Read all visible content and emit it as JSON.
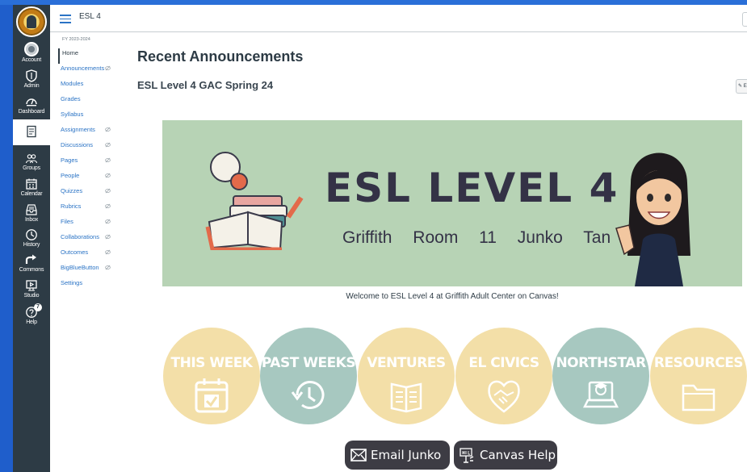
{
  "global_nav": {
    "items": [
      {
        "label": "Account",
        "icon": "account-avatar"
      },
      {
        "label": "Admin",
        "icon": "shield-icon"
      },
      {
        "label": "Dashboard",
        "icon": "dashboard-icon"
      },
      {
        "label": "",
        "icon": "courses-icon"
      },
      {
        "label": "Groups",
        "icon": "groups-icon"
      },
      {
        "label": "Calendar",
        "icon": "calendar-icon"
      },
      {
        "label": "Inbox",
        "icon": "inbox-icon"
      },
      {
        "label": "History",
        "icon": "history-icon"
      },
      {
        "label": "Commons",
        "icon": "commons-icon"
      },
      {
        "label": "Studio",
        "icon": "studio-icon"
      },
      {
        "label": "Help",
        "icon": "help-icon",
        "badge": "7"
      }
    ]
  },
  "header": {
    "course_name": "ESL 4"
  },
  "course_nav": {
    "term": "FY 2023-2024",
    "items": [
      {
        "label": "Home",
        "hidden": false,
        "active": true
      },
      {
        "label": "Announcements",
        "hidden": true
      },
      {
        "label": "Modules",
        "hidden": false
      },
      {
        "label": "Grades",
        "hidden": false
      },
      {
        "label": "Syllabus",
        "hidden": false
      },
      {
        "label": "Assignments",
        "hidden": true
      },
      {
        "label": "Discussions",
        "hidden": true
      },
      {
        "label": "Pages",
        "hidden": true
      },
      {
        "label": "People",
        "hidden": true
      },
      {
        "label": "Quizzes",
        "hidden": true
      },
      {
        "label": "Rubrics",
        "hidden": true
      },
      {
        "label": "Files",
        "hidden": true
      },
      {
        "label": "Collaborations",
        "hidden": true
      },
      {
        "label": "Outcomes",
        "hidden": true
      },
      {
        "label": "BigBlueButton",
        "hidden": true
      },
      {
        "label": "Settings",
        "hidden": false
      }
    ]
  },
  "main": {
    "page_title": "Recent Announcements",
    "announcement_title": "ESL Level 4 GAC Spring 24",
    "edit_label": "✎ E",
    "banner": {
      "title": "ESL LEVEL 4",
      "subtitle": "Griffith Room 11 Junko Tan"
    },
    "welcome": "Welcome to ESL Level 4 at Griffith Adult Center on Canvas!",
    "circles": [
      {
        "label": "THIS WEEK",
        "color": "#f3dfa8",
        "icon": "calendar-check-icon"
      },
      {
        "label": "PAST WEEKS",
        "color": "#a7c8c0",
        "icon": "history-icon"
      },
      {
        "label": "VENTURES",
        "color": "#f3dfa8",
        "icon": "book-icon"
      },
      {
        "label": "EL CIVICS",
        "color": "#f3dfa8",
        "icon": "handshake-heart-icon"
      },
      {
        "label": "NORTHSTAR",
        "color": "#a7c8c0",
        "icon": "laptop-graduate-icon"
      },
      {
        "label": "RESOURCES",
        "color": "#f3dfa8",
        "icon": "folder-icon"
      }
    ],
    "buttons": [
      {
        "label": "Email Junko",
        "icon": "mail-icon"
      },
      {
        "label": "Canvas Help",
        "icon": "help-sign-icon"
      }
    ]
  },
  "colors": {
    "nav_bg": "#2d3b45",
    "link": "#2a73c5",
    "banner_bg": "#b7d3b5",
    "frame_blue": "#1f5ecb"
  }
}
